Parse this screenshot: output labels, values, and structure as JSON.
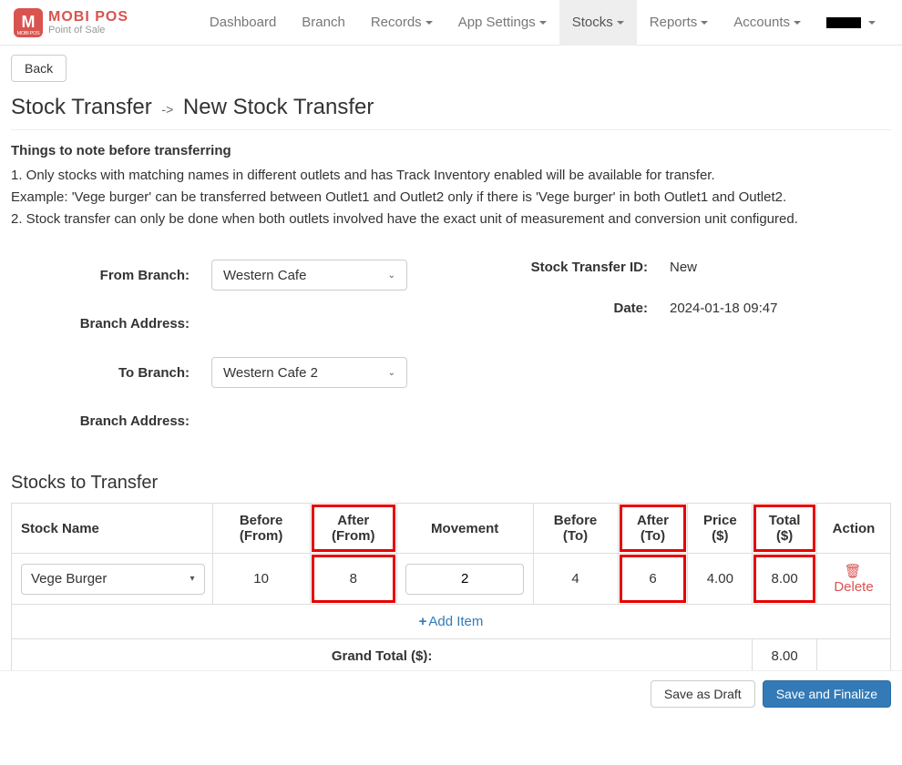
{
  "brand": {
    "name": "MOBI POS",
    "tagline": "Point of Sale",
    "icon_letter": "M",
    "icon_sub": "MOBI POS"
  },
  "nav": {
    "dashboard": "Dashboard",
    "branch": "Branch",
    "records": "Records",
    "app_settings": "App Settings",
    "stocks": "Stocks",
    "reports": "Reports",
    "accounts": "Accounts"
  },
  "back_label": "Back",
  "title": {
    "crumb": "Stock Transfer",
    "arrow": "->",
    "page": "New Stock Transfer"
  },
  "notes": {
    "heading": "Things to note before transferring",
    "line1": "1. Only stocks with matching names in different outlets and has Track Inventory enabled will be available for transfer.",
    "example": "Example: 'Vege burger' can be transferred between Outlet1 and Outlet2 only if there is 'Vege burger' in both Outlet1 and Outlet2.",
    "line2": "2. Stock transfer can only be done when both outlets involved have the exact unit of measurement and conversion unit configured."
  },
  "form": {
    "from_branch_label": "From Branch:",
    "from_branch_value": "Western Cafe",
    "branch_address_label": "Branch Address:",
    "to_branch_label": "To Branch:",
    "to_branch_value": "Western Cafe 2",
    "transfer_id_label": "Stock Transfer ID:",
    "transfer_id_value": "New",
    "date_label": "Date:",
    "date_value": "2024-01-18 09:47"
  },
  "stocks": {
    "section_title": "Stocks to Transfer",
    "headers": {
      "stock_name": "Stock Name",
      "before_from": "Before (From)",
      "after_from": "After (From)",
      "movement": "Movement",
      "before_to": "Before (To)",
      "after_to": "After (To)",
      "price": "Price ($)",
      "total": "Total ($)",
      "action": "Action"
    },
    "rows": [
      {
        "name": "Vege Burger",
        "before_from": "10",
        "after_from": "8",
        "movement": "2",
        "before_to": "4",
        "after_to": "6",
        "price": "4.00",
        "total": "8.00"
      }
    ],
    "delete_label": "Delete",
    "add_item_label": "Add Item",
    "grand_total_label": "Grand Total ($):",
    "grand_total_value": "8.00"
  },
  "footer": {
    "save_draft": "Save as Draft",
    "save_finalize": "Save and Finalize"
  }
}
